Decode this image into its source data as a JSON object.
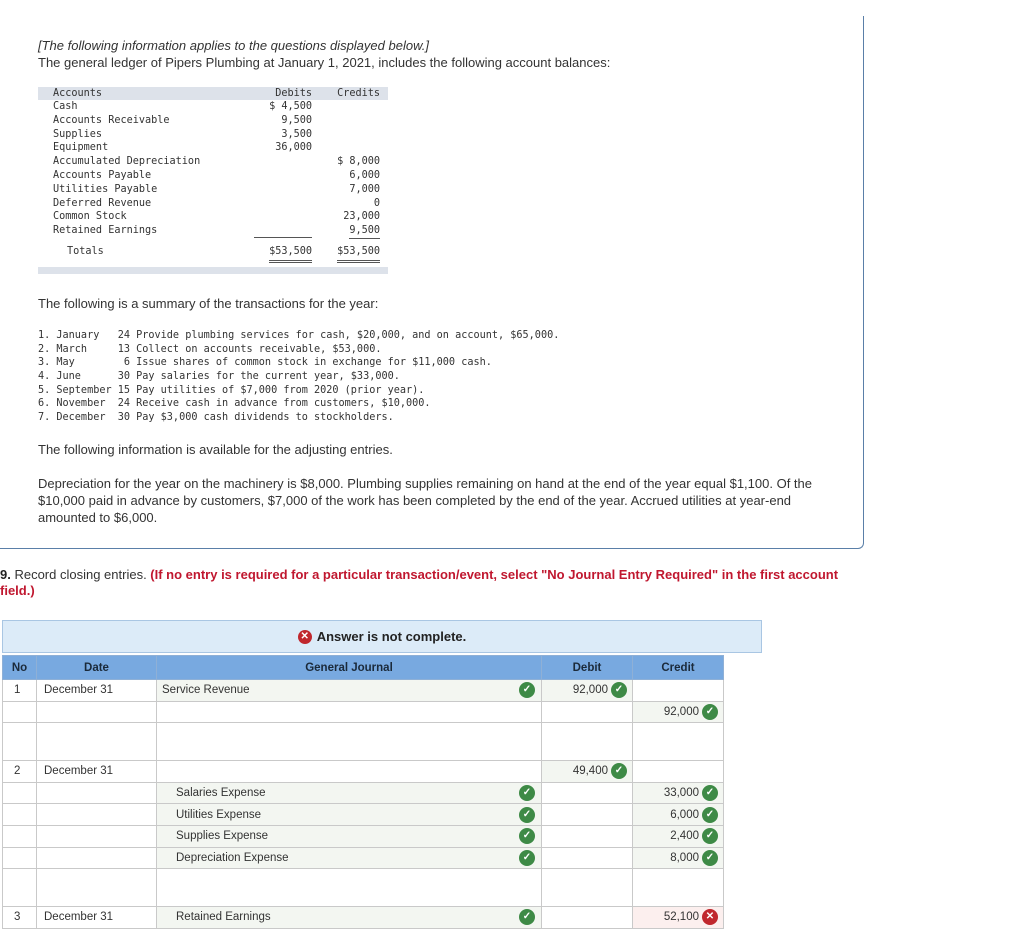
{
  "problem": {
    "intro_italic": "[The following information applies to the questions displayed below.]",
    "intro_line": "The general ledger of Pipers Plumbing at January 1, 2021, includes the following account balances:",
    "ledger": {
      "headers": {
        "accounts": "Accounts",
        "debits": "Debits",
        "credits": "Credits"
      },
      "rows": [
        {
          "account": "Cash",
          "debit": "$ 4,500",
          "credit": ""
        },
        {
          "account": "Accounts Receivable",
          "debit": "9,500",
          "credit": ""
        },
        {
          "account": "Supplies",
          "debit": "3,500",
          "credit": ""
        },
        {
          "account": "Equipment",
          "debit": "36,000",
          "credit": ""
        },
        {
          "account": "Accumulated Depreciation",
          "debit": "",
          "credit": "$ 8,000"
        },
        {
          "account": "Accounts Payable",
          "debit": "",
          "credit": "6,000"
        },
        {
          "account": "Utilities Payable",
          "debit": "",
          "credit": "7,000"
        },
        {
          "account": "Deferred Revenue",
          "debit": "",
          "credit": "0"
        },
        {
          "account": "Common Stock",
          "debit": "",
          "credit": "23,000"
        },
        {
          "account": "Retained Earnings",
          "debit": "",
          "credit": "9,500"
        }
      ],
      "totals": {
        "label": "Totals",
        "debit": "$53,500",
        "credit": "$53,500"
      }
    },
    "summary_heading": "The following is a summary of the transactions for the year:",
    "transactions": [
      "1. January   24 Provide plumbing services for cash, $20,000, and on account, $65,000.",
      "2. March     13 Collect on accounts receivable, $53,000.",
      "3. May        6 Issue shares of common stock in exchange for $11,000 cash.",
      "4. June      30 Pay salaries for the current year, $33,000.",
      "5. September 15 Pay utilities of $7,000 from 2020 (prior year).",
      "6. November  24 Receive cash in advance from customers, $10,000.",
      "7. December  30 Pay $3,000 cash dividends to stockholders."
    ],
    "adjusting_heading": "The following information is available for the adjusting entries.",
    "adjusting_body": "Depreciation for the year on the machinery is $8,000. Plumbing supplies remaining on hand at the end of the year equal $1,100. Of the $10,000 paid in advance by customers, $7,000 of the work has been completed by the end of the year. Accrued utilities at year-end amounted to $6,000."
  },
  "question": {
    "number": "9.",
    "text": " Record closing entries. ",
    "note": "(If no entry is required for a particular transaction/event, select \"No Journal Entry Required\" in the first account field.)"
  },
  "status": {
    "icon": "x-circle-icon",
    "message": "Answer is not complete.",
    "color": "#c0272d"
  },
  "journal": {
    "headers": {
      "no": "No",
      "date": "Date",
      "general_journal": "General Journal",
      "debit": "Debit",
      "credit": "Credit"
    },
    "rows": [
      {
        "no": "1",
        "date": "December 31",
        "account": "Service Revenue",
        "indent": false,
        "account_status": "correct",
        "debit": "92,000",
        "debit_status": "correct",
        "credit": "",
        "credit_status": ""
      },
      {
        "no": "",
        "date": "",
        "account": "",
        "indent": true,
        "account_status": "",
        "debit": "",
        "debit_status": "",
        "credit": "92,000",
        "credit_status": "correct"
      },
      {
        "no": "",
        "date": "",
        "account": "",
        "indent": false,
        "account_status": "",
        "debit": "",
        "debit_status": "",
        "credit": "",
        "credit_status": ""
      },
      {
        "no": "2",
        "date": "December 31",
        "account": "",
        "indent": false,
        "account_status": "",
        "debit": "49,400",
        "debit_status": "correct",
        "credit": "",
        "credit_status": ""
      },
      {
        "no": "",
        "date": "",
        "account": "Salaries Expense",
        "indent": true,
        "account_status": "correct",
        "debit": "",
        "debit_status": "",
        "credit": "33,000",
        "credit_status": "correct"
      },
      {
        "no": "",
        "date": "",
        "account": "Utilities Expense",
        "indent": true,
        "account_status": "correct",
        "debit": "",
        "debit_status": "",
        "credit": "6,000",
        "credit_status": "correct"
      },
      {
        "no": "",
        "date": "",
        "account": "Supplies Expense",
        "indent": true,
        "account_status": "correct",
        "debit": "",
        "debit_status": "",
        "credit": "2,400",
        "credit_status": "correct"
      },
      {
        "no": "",
        "date": "",
        "account": "Depreciation Expense",
        "indent": true,
        "account_status": "correct",
        "debit": "",
        "debit_status": "",
        "credit": "8,000",
        "credit_status": "correct"
      },
      {
        "no": "",
        "date": "",
        "account": "",
        "indent": false,
        "account_status": "",
        "debit": "",
        "debit_status": "",
        "credit": "",
        "credit_status": ""
      },
      {
        "no": "3",
        "date": "December 31",
        "account": "Retained Earnings",
        "indent": true,
        "account_status": "correct",
        "debit": "",
        "debit_status": "",
        "credit": "52,100",
        "credit_status": "incorrect"
      }
    ]
  },
  "colors": {
    "correct": "#3e8a46",
    "incorrect": "#c0272d",
    "header_blue": "#78a9e0",
    "status_bg": "#dcebf8",
    "note_red": "#c0172f"
  }
}
